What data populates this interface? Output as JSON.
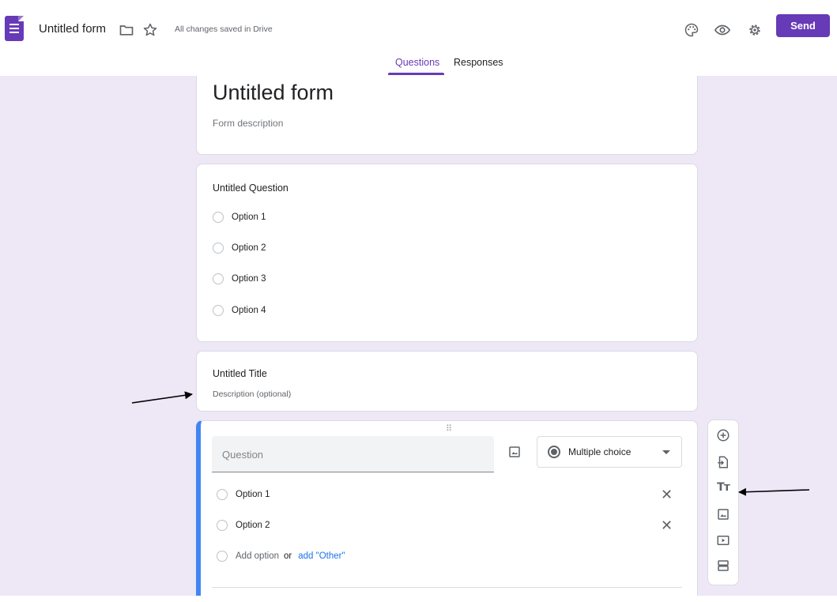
{
  "header": {
    "app_icon": "google-forms-icon",
    "doc_title": "Untitled form",
    "saved_status": "All changes saved in Drive",
    "icons": [
      "folder-icon",
      "star-icon",
      "palette-icon",
      "eye-icon",
      "gear-icon"
    ],
    "send_label": "Send",
    "accent_color": "#673ab7"
  },
  "tabs": [
    {
      "label": "Questions",
      "active": true
    },
    {
      "label": "Responses",
      "active": false
    }
  ],
  "form_header": {
    "title": "Untitled form",
    "description_placeholder": "Form description"
  },
  "question1": {
    "title": "Untitled Question",
    "options": [
      "Option 1",
      "Option 2",
      "Option 3",
      "Option 4"
    ]
  },
  "title_block": {
    "title": "Untitled Title",
    "description_placeholder": "Description (optional)"
  },
  "active_question": {
    "placeholder": "Question",
    "type": "Multiple choice",
    "options": [
      "Option 1",
      "Option 2"
    ],
    "add_option": "Add option",
    "or": "or",
    "add_other": "add \"Other\""
  },
  "toolbar": {
    "icons": [
      "add-question-icon",
      "import-questions-icon",
      "add-title-icon",
      "add-image-icon",
      "add-video-icon",
      "add-section-icon"
    ]
  },
  "background_color": "#ede7f6",
  "active_border_color": "#4285f4"
}
